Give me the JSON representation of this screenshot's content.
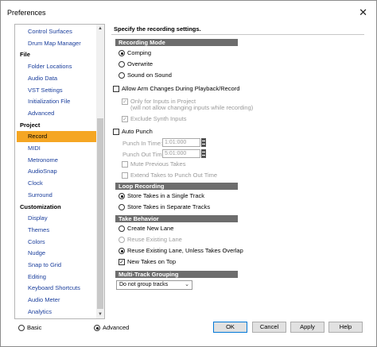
{
  "window": {
    "title": "Preferences"
  },
  "sidebar": {
    "items": [
      {
        "label": "Control Surfaces",
        "type": "item"
      },
      {
        "label": "Drum Map Manager",
        "type": "item"
      },
      {
        "label": "File",
        "type": "category"
      },
      {
        "label": "Folder Locations",
        "type": "item"
      },
      {
        "label": "Audio Data",
        "type": "item"
      },
      {
        "label": "VST Settings",
        "type": "item"
      },
      {
        "label": "Initialization File",
        "type": "item"
      },
      {
        "label": "Advanced",
        "type": "item"
      },
      {
        "label": "Project",
        "type": "category"
      },
      {
        "label": "Record",
        "type": "item",
        "selected": true
      },
      {
        "label": "MIDI",
        "type": "item"
      },
      {
        "label": "Metronome",
        "type": "item"
      },
      {
        "label": "AudioSnap",
        "type": "item"
      },
      {
        "label": "Clock",
        "type": "item"
      },
      {
        "label": "Surround",
        "type": "item"
      },
      {
        "label": "Customization",
        "type": "category"
      },
      {
        "label": "Display",
        "type": "item"
      },
      {
        "label": "Themes",
        "type": "item"
      },
      {
        "label": "Colors",
        "type": "item"
      },
      {
        "label": "Nudge",
        "type": "item"
      },
      {
        "label": "Snap to Grid",
        "type": "item"
      },
      {
        "label": "Editing",
        "type": "item"
      },
      {
        "label": "Keyboard Shortcuts",
        "type": "item"
      },
      {
        "label": "Audio Meter",
        "type": "item"
      },
      {
        "label": "Analytics",
        "type": "item"
      }
    ]
  },
  "content": {
    "heading": "Specify the recording settings.",
    "recording_mode": {
      "title": "Recording Mode",
      "comping": "Comping",
      "overwrite": "Overwrite",
      "sound_on_sound": "Sound on Sound"
    },
    "allow_arm": "Allow Arm Changes During Playback/Record",
    "only_inputs_line1": "Only for Inputs in Project",
    "only_inputs_line2": "(will not allow changing inputs while recording)",
    "exclude_synth": "Exclude Synth Inputs",
    "auto_punch": "Auto Punch",
    "punch_in_label": "Punch In Time:",
    "punch_in_value": "1:01:000",
    "punch_out_label": "Punch Out Time:",
    "punch_out_value": "5:01:000",
    "mute_previous": "Mute Previous Takes",
    "extend_takes": "Extend Takes to Punch Out Time",
    "loop_recording": {
      "title": "Loop Recording",
      "single_track": "Store Takes in a Single Track",
      "separate_tracks": "Store Takes in Separate Tracks"
    },
    "take_behavior": {
      "title": "Take Behavior",
      "create_new_lane": "Create New Lane",
      "reuse_existing_lane": "Reuse Existing Lane",
      "reuse_unless_overlap": "Reuse Existing Lane, Unless Takes Overlap",
      "new_takes_on_top": "New Takes on Top"
    },
    "multitrack": {
      "title": "Multi-Track Grouping",
      "selected": "Do not group tracks"
    }
  },
  "footer": {
    "basic": "Basic",
    "advanced": "Advanced",
    "ok": "OK",
    "cancel": "Cancel",
    "apply": "Apply",
    "help": "Help"
  },
  "colors": {
    "selection": "#f5a623",
    "section_bar": "#6d6d6d",
    "link": "#1a3e9c",
    "default_button_border": "#0078d7"
  },
  "icons": {
    "close": "close-icon",
    "scroll_up": "chevron-up-icon",
    "scroll_down": "chevron-down-icon",
    "dropdown": "chevron-down-icon"
  }
}
